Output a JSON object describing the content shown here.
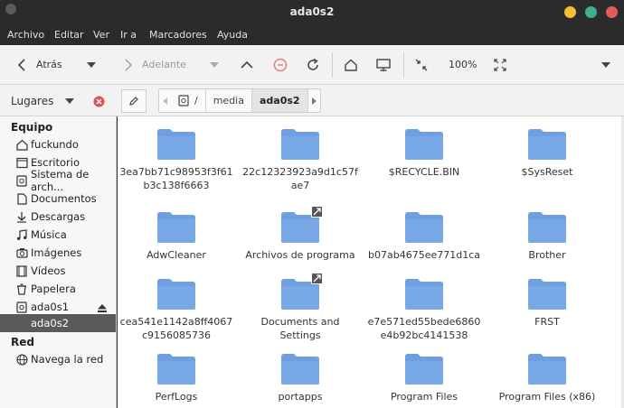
{
  "window": {
    "title": "ada0s2"
  },
  "colors": {
    "close": "#e45b5b",
    "maximize": "#3cb08d",
    "minimize": "#f5bd36",
    "folder": "#6f9fe0",
    "selected": "#5a5a5a"
  },
  "menu": [
    "Archivo",
    "Editar",
    "Ver",
    "Ir a",
    "Marcadores",
    "Ayuda"
  ],
  "toolbar": {
    "back_label": "Atrás",
    "forward_label": "Adelante",
    "zoom": "100%"
  },
  "location": {
    "places_label": "Lugares",
    "crumbs": [
      "/",
      "media",
      "ada0s2"
    ]
  },
  "sidebar": {
    "section_equipo": "Equipo",
    "section_red": "Red",
    "items": [
      {
        "label": "fuckundo",
        "icon": "home-icon"
      },
      {
        "label": "Escritorio",
        "icon": "desktop-icon"
      },
      {
        "label": "Sistema de arch...",
        "icon": "filesystem-icon"
      },
      {
        "label": "Documentos",
        "icon": "document-icon"
      },
      {
        "label": "Descargas",
        "icon": "download-icon"
      },
      {
        "label": "Música",
        "icon": "music-icon"
      },
      {
        "label": "Imágenes",
        "icon": "camera-icon"
      },
      {
        "label": "Vídeos",
        "icon": "film-icon"
      },
      {
        "label": "Papelera",
        "icon": "trash-icon"
      },
      {
        "label": "ada0s1",
        "icon": "drive-icon"
      },
      {
        "label": "ada0s2",
        "icon": "drive-icon"
      }
    ],
    "network_items": [
      {
        "label": "Navega la red",
        "icon": "network-icon"
      }
    ]
  },
  "files": [
    {
      "name": "3ea7bb71c98953f3f61b3c138f6663",
      "link": false
    },
    {
      "name": "22c12323923a9d1c57fae7",
      "link": false
    },
    {
      "name": "$RECYCLE.BIN",
      "link": false
    },
    {
      "name": "$SysReset",
      "link": false
    },
    {
      "name": "AdwCleaner",
      "link": false
    },
    {
      "name": "Archivos de programa",
      "link": true
    },
    {
      "name": "b07ab4675ee771d1ca",
      "link": false
    },
    {
      "name": "Brother",
      "link": false
    },
    {
      "name": "cea541e1142a8ff4067c9156085736",
      "link": false
    },
    {
      "name": "Documents and Settings",
      "link": true
    },
    {
      "name": "e7e571ed55bede6860e4b92bc4141538",
      "link": false
    },
    {
      "name": "FRST",
      "link": false
    },
    {
      "name": "PerfLogs",
      "link": false
    },
    {
      "name": "portapps",
      "link": false
    },
    {
      "name": "Program Files",
      "link": false
    },
    {
      "name": "Program Files (x86)",
      "link": false
    }
  ]
}
